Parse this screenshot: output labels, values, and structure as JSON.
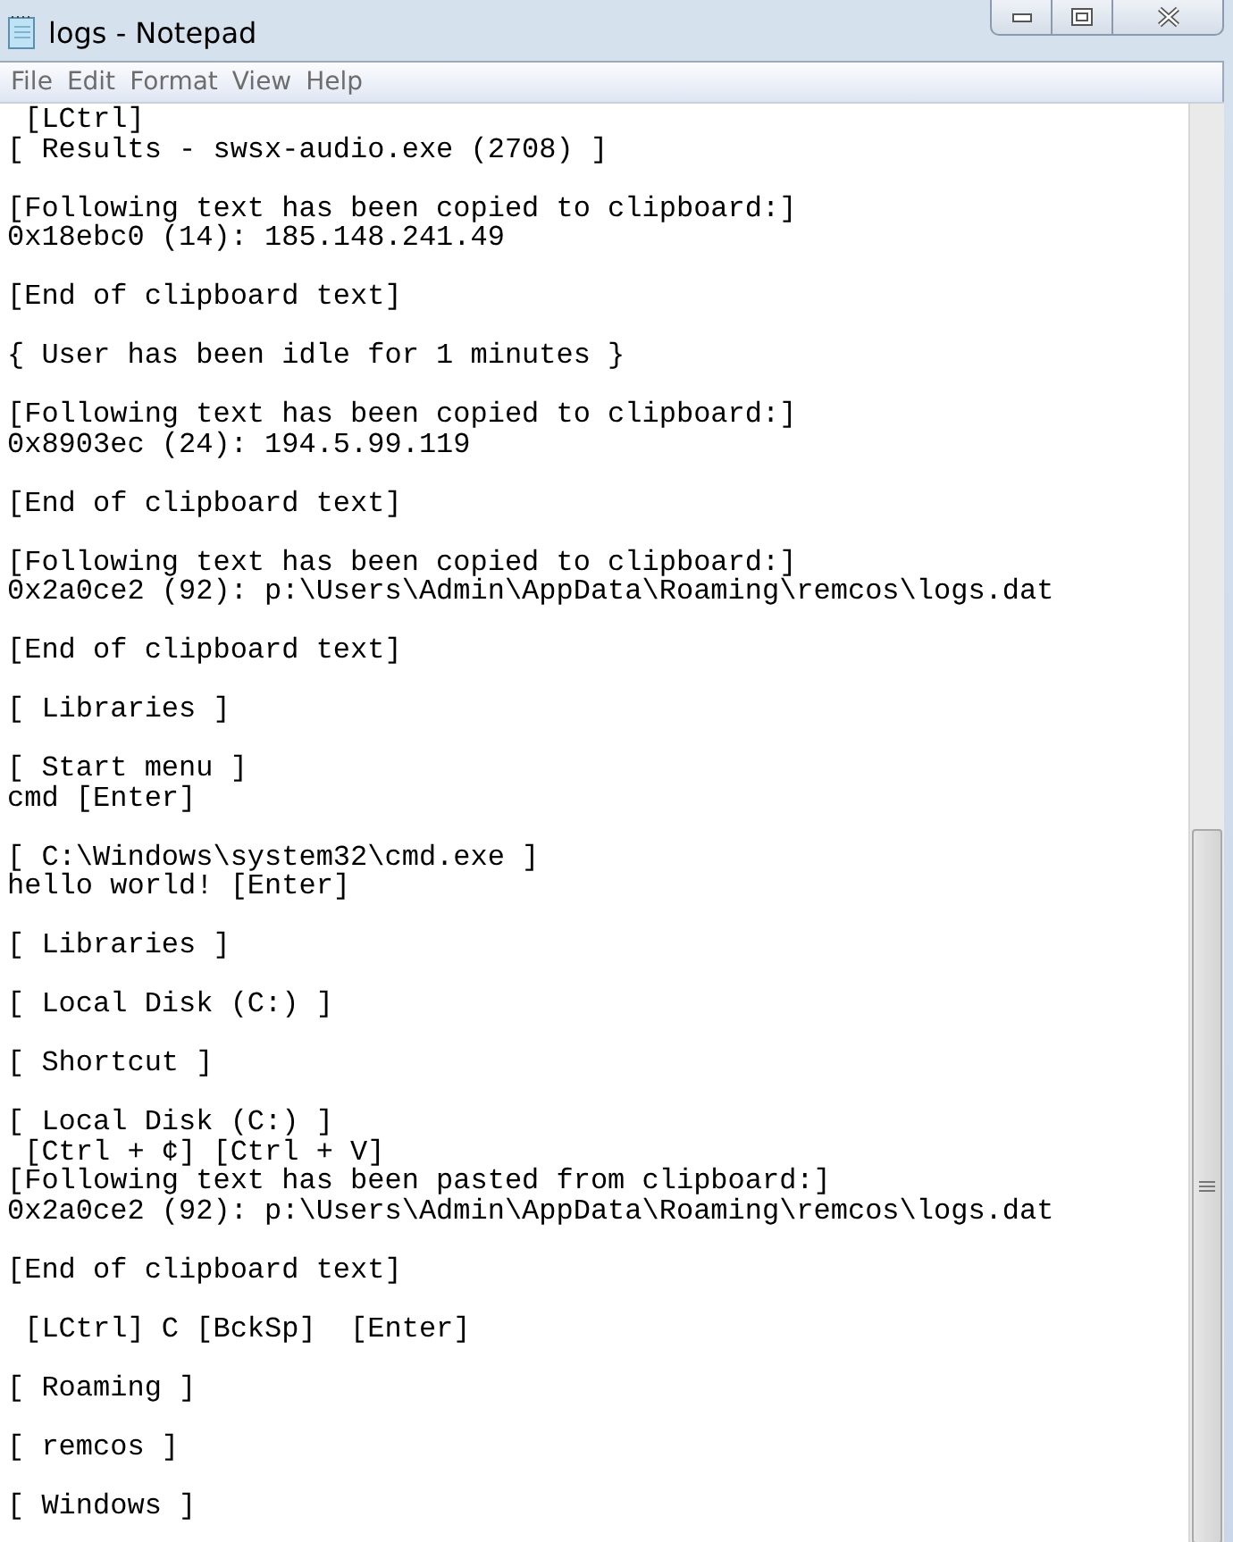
{
  "window": {
    "title": "logs - Notepad"
  },
  "menu": [
    "File",
    "Edit",
    "Format",
    "View",
    "Help"
  ],
  "blocks": [
    [
      " [LCtrl]",
      "[ Results - swsx-audio.exe (2708) ]"
    ],
    [
      "[Following text has been copied to clipboard:]",
      "0x18ebc0 (14): 185.148.241.49"
    ],
    [
      "[End of clipboard text]"
    ],
    [
      "{ User has been idle for 1 minutes }"
    ],
    [
      "[Following text has been copied to clipboard:]",
      "0x8903ec (24): 194.5.99.119"
    ],
    [
      "[End of clipboard text]"
    ],
    [
      "[Following text has been copied to clipboard:]",
      "0x2a0ce2 (92): p:\\Users\\Admin\\AppData\\Roaming\\remcos\\logs.dat"
    ],
    [
      "[End of clipboard text]"
    ],
    [
      "[ Libraries ]"
    ],
    [
      "[ Start menu ]",
      "cmd [Enter]"
    ],
    [
      "[ C:\\Windows\\system32\\cmd.exe ]",
      "hello world! [Enter]"
    ],
    [
      "[ Libraries ]"
    ],
    [
      "[ Local Disk (C:) ]"
    ],
    [
      "[ Shortcut ]"
    ],
    [
      "[ Local Disk (C:) ]",
      " [Ctrl + ¢] [Ctrl + V]",
      "[Following text has been pasted from clipboard:]",
      "0x2a0ce2 (92): p:\\Users\\Admin\\AppData\\Roaming\\remcos\\logs.dat"
    ],
    [
      "[End of clipboard text]"
    ],
    [
      " [LCtrl] C [BckSp]  [Enter]"
    ],
    [
      "[ Roaming ]"
    ],
    [
      "[ remcos ]"
    ],
    [
      "[ Windows ]"
    ]
  ]
}
